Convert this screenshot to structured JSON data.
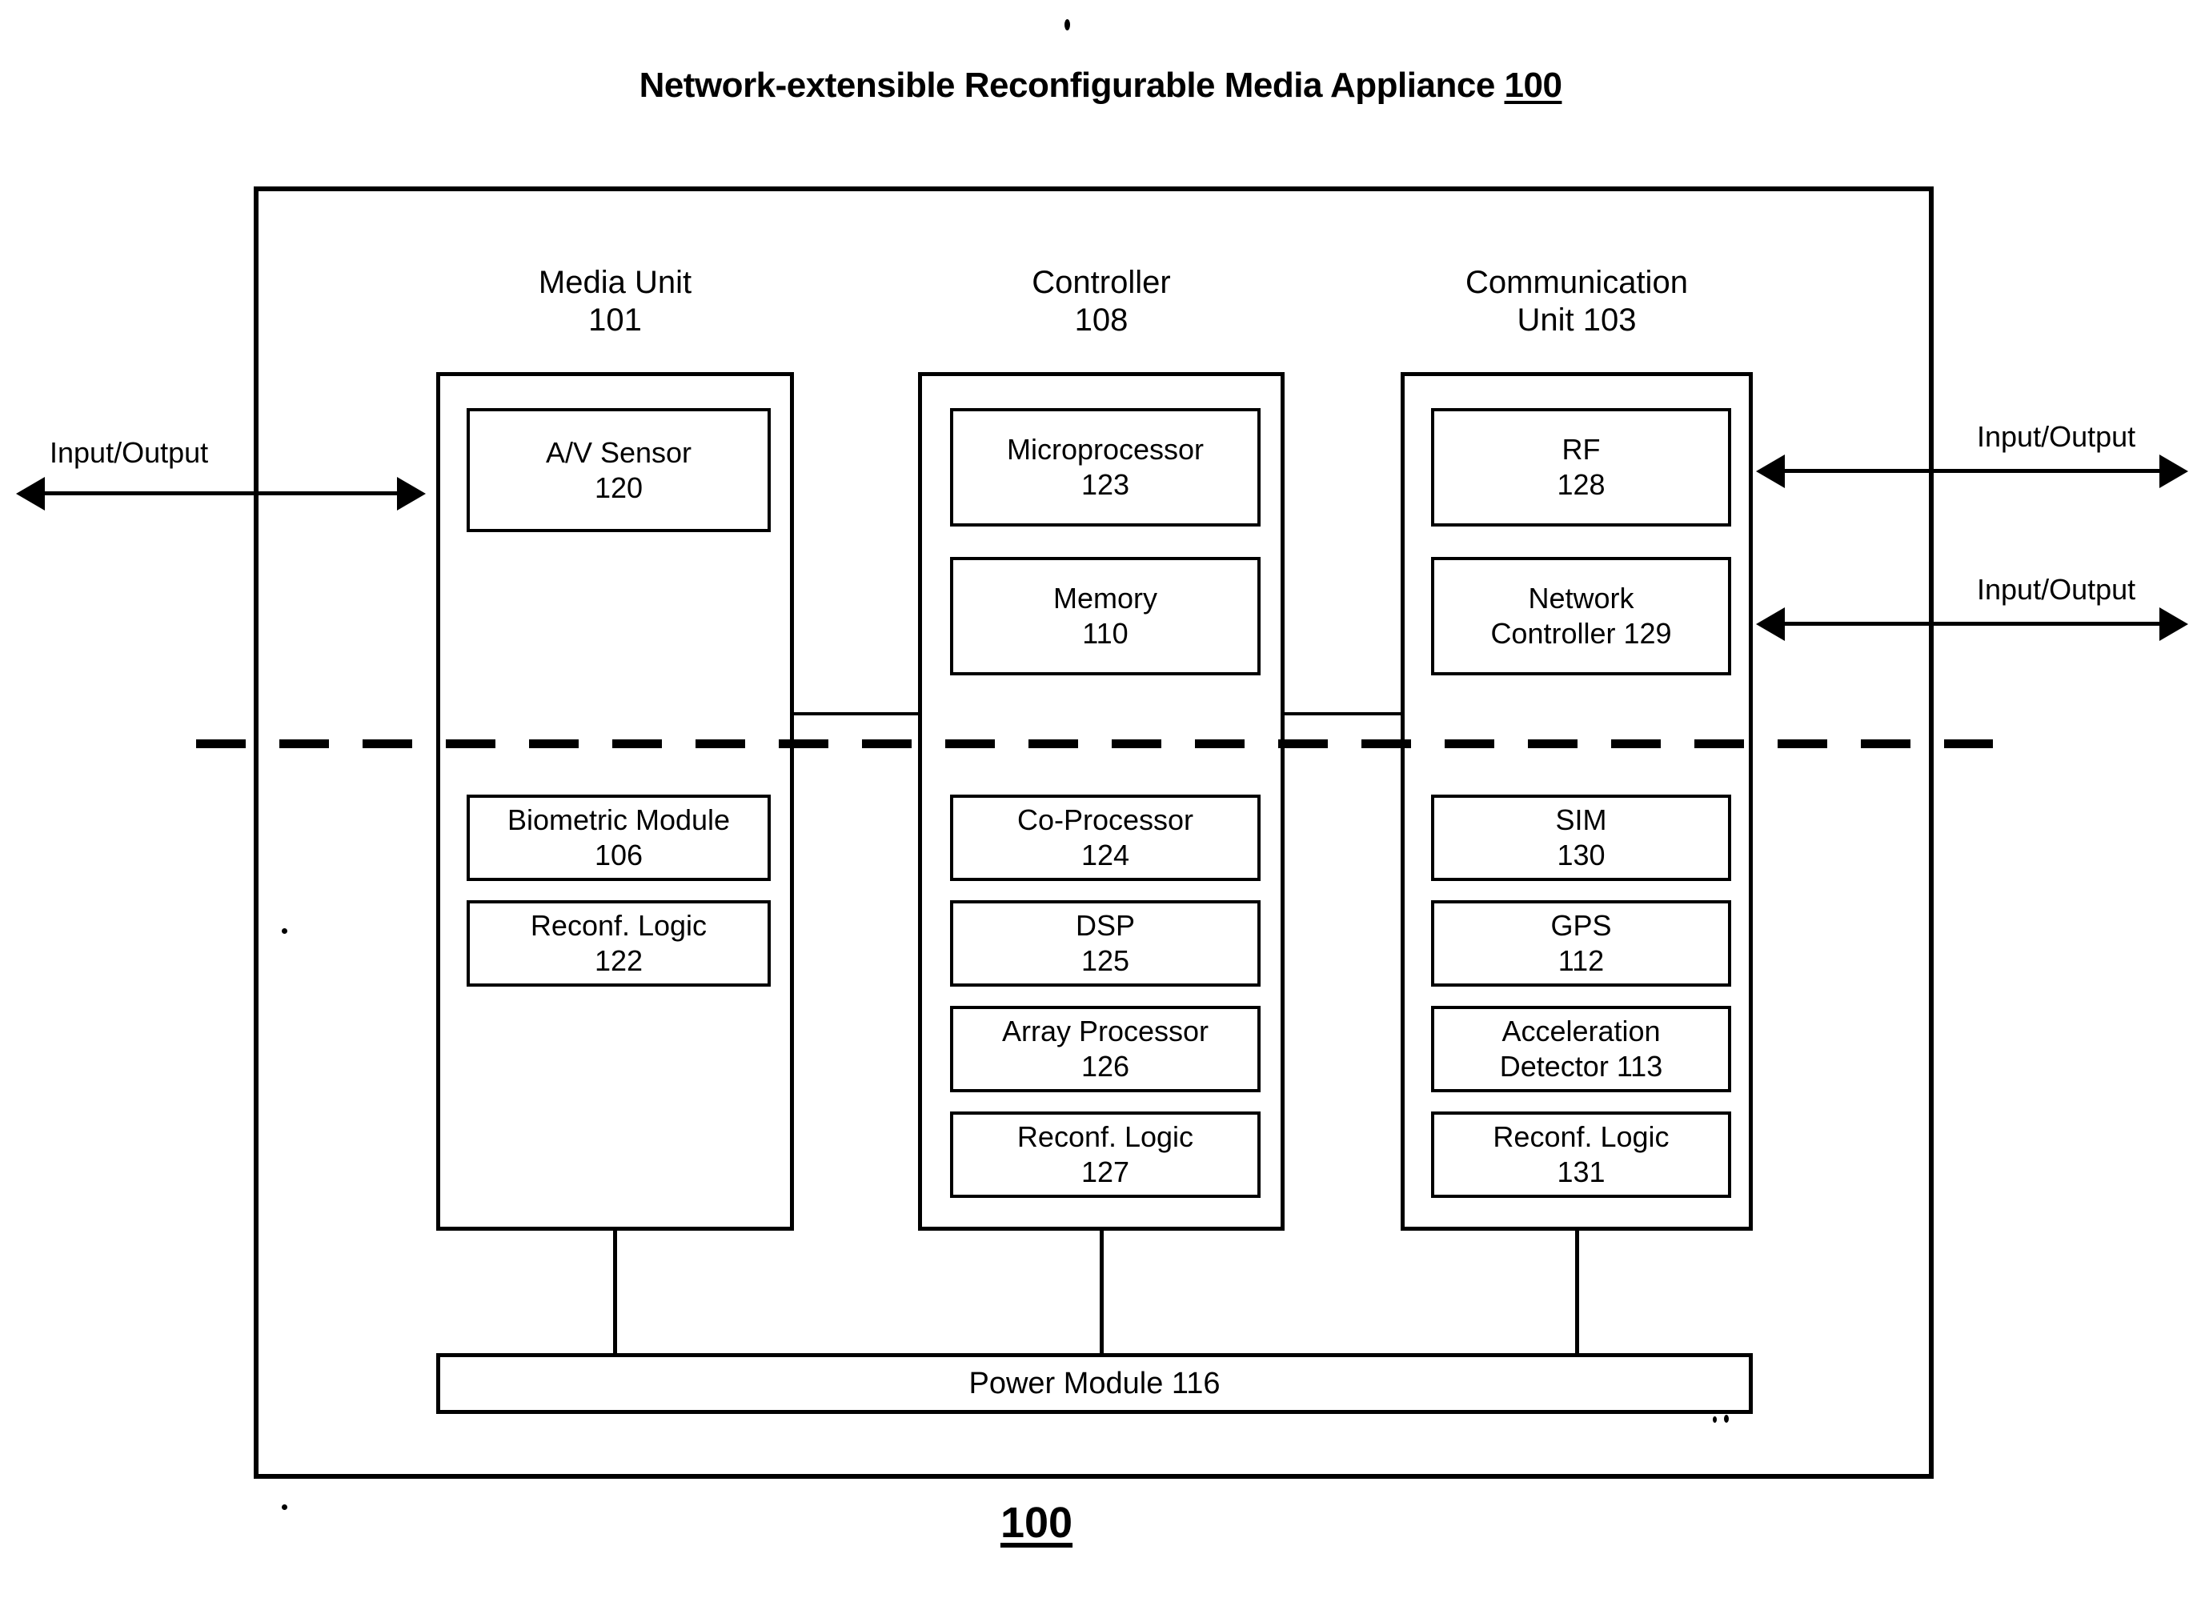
{
  "figure": {
    "title_text": "Network-extensible Reconfigurable Media Appliance ",
    "title_number": "100",
    "bottom_reference": "100"
  },
  "units": [
    {
      "id": "media-unit",
      "heading": "Media Unit\n101",
      "name": "Media Unit",
      "number": "101",
      "components_above": [
        {
          "name": "A/V Sensor",
          "number": "120"
        }
      ],
      "components_below": [
        {
          "name": "Biometric Module",
          "number": "106"
        },
        {
          "name": "Reconf. Logic",
          "number": "122"
        }
      ]
    },
    {
      "id": "controller",
      "heading": "Controller\n108",
      "name": "Controller",
      "number": "108",
      "components_above": [
        {
          "name": "Microprocessor",
          "number": "123"
        },
        {
          "name": "Memory",
          "number": "110"
        }
      ],
      "components_below": [
        {
          "name": "Co-Processor",
          "number": "124"
        },
        {
          "name": "DSP",
          "number": "125"
        },
        {
          "name": "Array Processor",
          "number": "126"
        },
        {
          "name": "Reconf. Logic",
          "number": "127"
        }
      ]
    },
    {
      "id": "communication-unit",
      "heading": "Communication\nUnit 103",
      "name": "Communication Unit",
      "number": "103",
      "components_above": [
        {
          "name": "RF",
          "number": "128"
        },
        {
          "name": "Network",
          "number": "Controller 129"
        }
      ],
      "components_below": [
        {
          "name": "SIM",
          "number": "130"
        },
        {
          "name": "GPS",
          "number": "112"
        },
        {
          "name": "Acceleration",
          "number": "Detector 113"
        },
        {
          "name": "Reconf. Logic",
          "number": "131"
        }
      ]
    }
  ],
  "power_module": {
    "label": "Power Module 116"
  },
  "io_arrows": [
    {
      "id": "io-left-media",
      "label": "Input/Output",
      "side": "left",
      "target": "Media Unit 101",
      "bidirectional": true
    },
    {
      "id": "io-right-rf",
      "label": "Input/Output",
      "side": "right",
      "target": "RF 128",
      "bidirectional": true
    },
    {
      "id": "io-right-network",
      "label": "Input/Output",
      "side": "right",
      "target": "Network Controller 129",
      "bidirectional": true
    }
  ],
  "colors": {
    "line": "#000000",
    "background": "#ffffff"
  }
}
